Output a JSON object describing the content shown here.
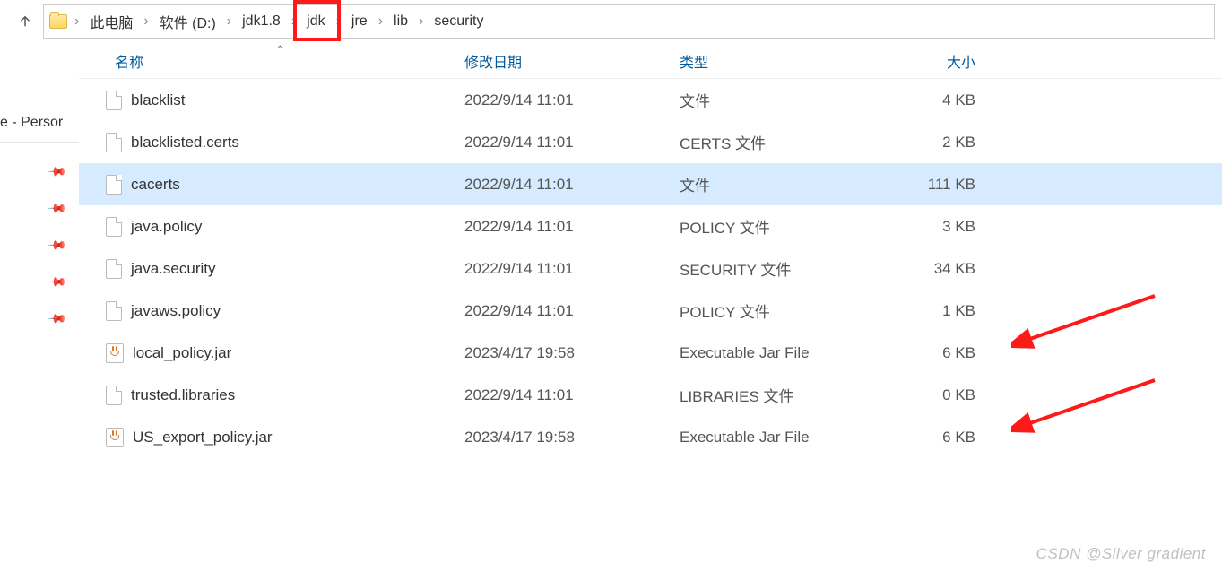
{
  "breadcrumb": {
    "items": [
      "此电脑",
      "软件 (D:)",
      "jdk1.8",
      "jdk",
      "jre",
      "lib",
      "security"
    ],
    "highlighted_index": 3
  },
  "sidebar": {
    "label_fragment": "e - Persor",
    "pin_count": 5
  },
  "columns": {
    "name": "名称",
    "date": "修改日期",
    "type": "类型",
    "size": "大小"
  },
  "files": [
    {
      "name": "blacklist",
      "date": "2022/9/14 11:01",
      "type": "文件",
      "size": "4 KB",
      "icon": "file",
      "selected": false,
      "arrow": false
    },
    {
      "name": "blacklisted.certs",
      "date": "2022/9/14 11:01",
      "type": "CERTS 文件",
      "size": "2 KB",
      "icon": "file",
      "selected": false,
      "arrow": false
    },
    {
      "name": "cacerts",
      "date": "2022/9/14 11:01",
      "type": "文件",
      "size": "111 KB",
      "icon": "file",
      "selected": true,
      "arrow": false
    },
    {
      "name": "java.policy",
      "date": "2022/9/14 11:01",
      "type": "POLICY 文件",
      "size": "3 KB",
      "icon": "file",
      "selected": false,
      "arrow": false
    },
    {
      "name": "java.security",
      "date": "2022/9/14 11:01",
      "type": "SECURITY 文件",
      "size": "34 KB",
      "icon": "file",
      "selected": false,
      "arrow": false
    },
    {
      "name": "javaws.policy",
      "date": "2022/9/14 11:01",
      "type": "POLICY 文件",
      "size": "1 KB",
      "icon": "file",
      "selected": false,
      "arrow": false
    },
    {
      "name": "local_policy.jar",
      "date": "2023/4/17 19:58",
      "type": "Executable Jar File",
      "size": "6 KB",
      "icon": "jar",
      "selected": false,
      "arrow": true
    },
    {
      "name": "trusted.libraries",
      "date": "2022/9/14 11:01",
      "type": "LIBRARIES 文件",
      "size": "0 KB",
      "icon": "file",
      "selected": false,
      "arrow": false
    },
    {
      "name": "US_export_policy.jar",
      "date": "2023/4/17 19:58",
      "type": "Executable Jar File",
      "size": "6 KB",
      "icon": "jar",
      "selected": false,
      "arrow": true
    }
  ],
  "watermark": "CSDN @Silver gradient"
}
